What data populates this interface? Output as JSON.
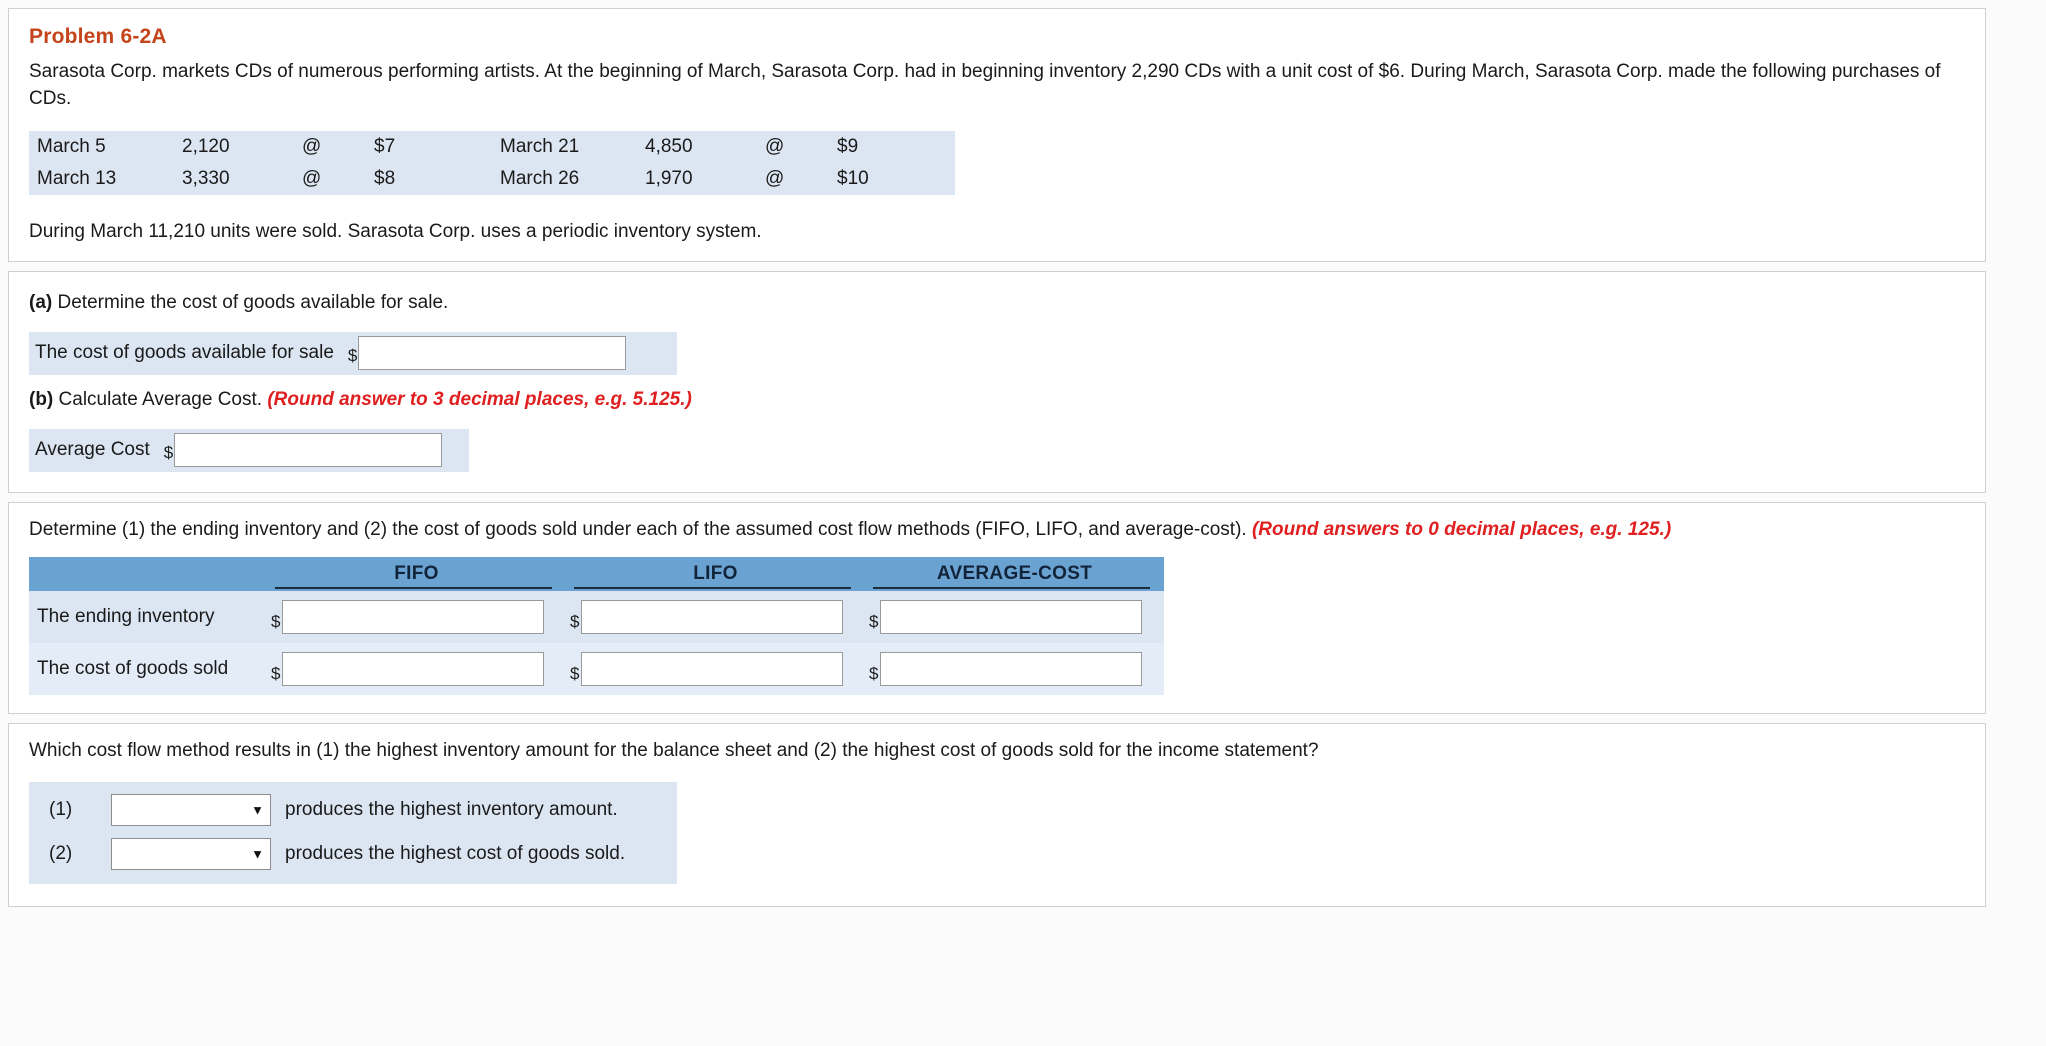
{
  "problem": {
    "title": "Problem 6-2A",
    "intro_paragraph": "Sarasota Corp. markets CDs of numerous performing artists. At the beginning of March, Sarasota Corp. had in beginning inventory 2,290 CDs with a unit cost of $6. During March, Sarasota Corp. made the following purchases of CDs.",
    "purchases": [
      {
        "date_left": "March 5",
        "qty_left": "2,120",
        "at_left": "@",
        "price_left": "$7",
        "date_right": "March 21",
        "qty_right": "4,850",
        "at_right": "@",
        "price_right": "$9"
      },
      {
        "date_left": "March 13",
        "qty_left": "3,330",
        "at_left": "@",
        "price_left": "$8",
        "date_right": "March 26",
        "qty_right": "1,970",
        "at_right": "@",
        "price_right": "$10"
      }
    ],
    "closing_sentence": "During March 11,210 units were sold. Sarasota Corp. uses a periodic inventory system."
  },
  "part_a": {
    "label": "(a)",
    "prompt": "Determine the cost of goods available for sale.",
    "row_label": "The cost of goods available for sale",
    "currency": "$",
    "value": "",
    "placeholder": ""
  },
  "part_b": {
    "label": "(b)",
    "prompt": "Calculate Average Cost.",
    "rounding_note": "(Round answer to 3 decimal places, e.g. 5.125.)",
    "row_label": "Average Cost",
    "currency": "$",
    "value": "",
    "placeholder": ""
  },
  "methods_section": {
    "instruction": "Determine (1) the ending inventory and (2) the cost of goods sold under each of the assumed cost flow methods (FIFO, LIFO, and average-cost).",
    "rounding_note": "(Round answers to 0 decimal places, e.g. 125.)",
    "columns": [
      "FIFO",
      "LIFO",
      "AVERAGE-COST"
    ],
    "header_color": "#6aa2d2",
    "rows": [
      {
        "label": "The ending inventory",
        "currency": "$",
        "values": [
          "",
          "",
          ""
        ]
      },
      {
        "label": "The cost of goods sold",
        "currency": "$",
        "values": [
          "",
          "",
          ""
        ]
      }
    ]
  },
  "final_section": {
    "question": "Which cost flow method results in (1) the highest inventory amount for the balance sheet and (2) the highest cost of goods sold for the income statement?",
    "rows": [
      {
        "number": "(1)",
        "selected": "",
        "caret": "▼",
        "suffix": "produces the highest inventory amount."
      },
      {
        "number": "(2)",
        "selected": "",
        "caret": "▼",
        "suffix": "produces the highest cost of goods sold."
      }
    ]
  },
  "colors": {
    "title_red": "#c4441c",
    "note_red": "#e02020",
    "band_blue": "#dce6f2",
    "header_blue": "#6aa2d2"
  }
}
